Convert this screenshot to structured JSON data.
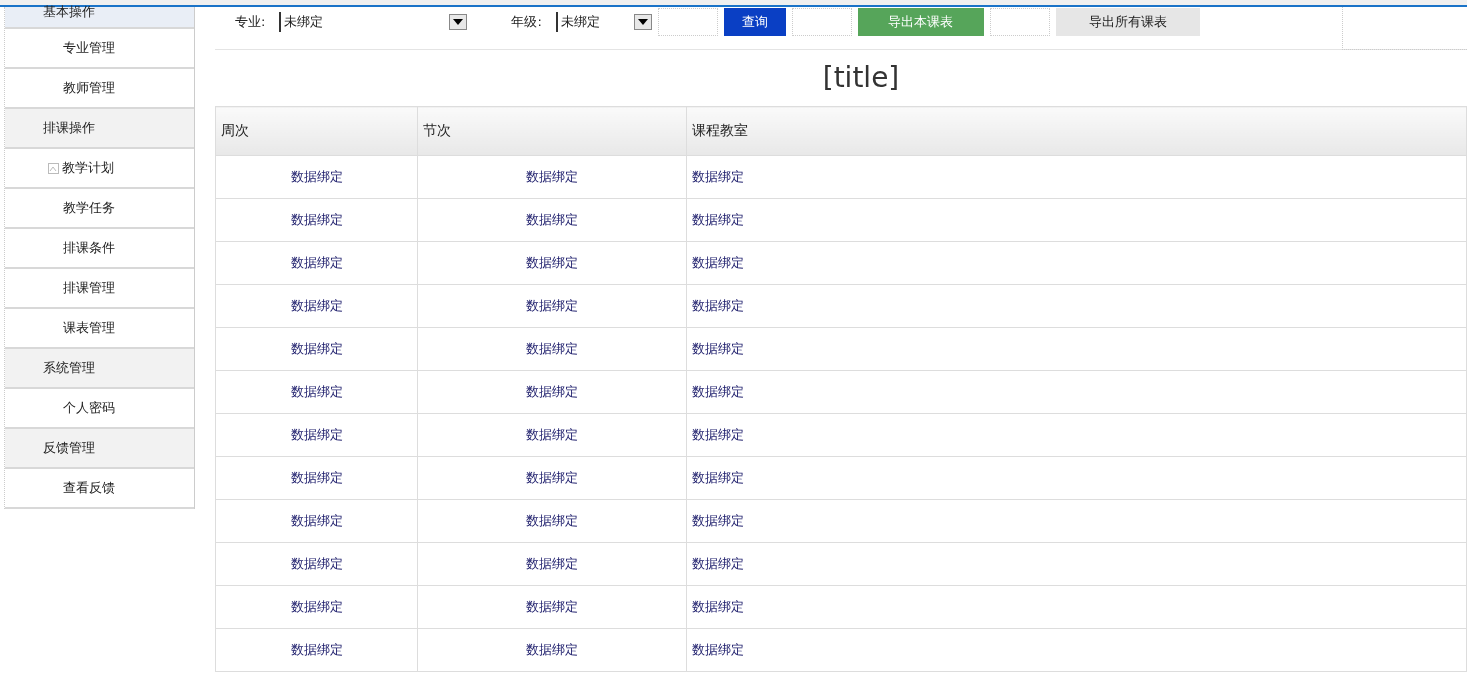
{
  "sidebar": {
    "groups": [
      {
        "label": "基本操作",
        "selected": true,
        "items": [
          {
            "label": "专业管理",
            "icon": false
          },
          {
            "label": "教师管理",
            "icon": false
          }
        ]
      },
      {
        "label": "排课操作",
        "selected": false,
        "items": [
          {
            "label": "教学计划",
            "icon": true
          },
          {
            "label": "教学任务",
            "icon": false
          },
          {
            "label": "排课条件",
            "icon": false
          },
          {
            "label": "排课管理",
            "icon": false
          },
          {
            "label": "课表管理",
            "icon": false
          }
        ]
      },
      {
        "label": "系统管理",
        "selected": false,
        "items": [
          {
            "label": "个人密码",
            "icon": false
          }
        ]
      },
      {
        "label": "反馈管理",
        "selected": false,
        "items": [
          {
            "label": "查看反馈",
            "icon": false
          }
        ]
      }
    ]
  },
  "toolbar": {
    "filters": [
      {
        "label": "专业:",
        "value": "未绑定"
      },
      {
        "label": "年级:",
        "value": "未绑定"
      }
    ],
    "buttons": [
      {
        "label": "查询",
        "kind": "primary"
      },
      {
        "label": "导出本课表",
        "kind": "success"
      },
      {
        "label": "导出所有课表",
        "kind": "default"
      }
    ]
  },
  "title": "[title]",
  "table": {
    "columns": [
      "周次",
      "节次",
      "课程教室"
    ],
    "rows": [
      [
        "数据绑定",
        "数据绑定",
        "数据绑定"
      ],
      [
        "数据绑定",
        "数据绑定",
        "数据绑定"
      ],
      [
        "数据绑定",
        "数据绑定",
        "数据绑定"
      ],
      [
        "数据绑定",
        "数据绑定",
        "数据绑定"
      ],
      [
        "数据绑定",
        "数据绑定",
        "数据绑定"
      ],
      [
        "数据绑定",
        "数据绑定",
        "数据绑定"
      ],
      [
        "数据绑定",
        "数据绑定",
        "数据绑定"
      ],
      [
        "数据绑定",
        "数据绑定",
        "数据绑定"
      ],
      [
        "数据绑定",
        "数据绑定",
        "数据绑定"
      ],
      [
        "数据绑定",
        "数据绑定",
        "数据绑定"
      ],
      [
        "数据绑定",
        "数据绑定",
        "数据绑定"
      ],
      [
        "数据绑定",
        "数据绑定",
        "数据绑定"
      ]
    ]
  }
}
